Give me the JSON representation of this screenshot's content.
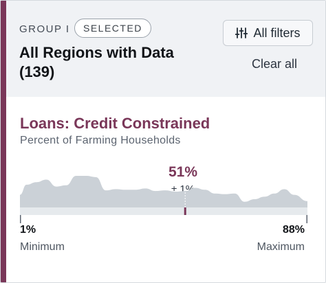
{
  "header": {
    "group_label": "GROUP I",
    "selected_badge": "SELECTED",
    "title": "All Regions with Data (139)",
    "all_filters_label": "All filters",
    "clear_all_label": "Clear all",
    "filters_icon": "sliders-icon"
  },
  "metric": {
    "title": "Loans: Credit Constrained",
    "subtitle": "Percent of Farming Households",
    "value": "51%",
    "margin_of_error": "± 1%",
    "min_value": "1%",
    "min_label": "Minimum",
    "max_value": "88%",
    "max_label": "Maximum"
  },
  "colors": {
    "accent": "#7a3759",
    "header_bg": "#f0f2f5",
    "distribution_fill": "#cbd1d7",
    "track": "#e6eaed"
  },
  "chart_data": {
    "type": "area",
    "x_range": [
      1,
      88
    ],
    "marker_value": 51,
    "x": [
      1,
      3,
      6,
      9,
      12,
      15,
      18,
      21,
      24,
      27,
      30,
      33,
      36,
      39,
      42,
      45,
      48,
      51,
      54,
      57,
      60,
      63,
      66,
      69,
      72,
      75,
      78,
      81,
      84,
      88
    ],
    "density": [
      0.4,
      0.72,
      0.8,
      0.88,
      0.66,
      0.7,
      1.0,
      1.0,
      0.96,
      0.54,
      0.58,
      0.56,
      0.56,
      0.6,
      0.52,
      0.54,
      0.5,
      0.52,
      0.62,
      0.56,
      0.44,
      0.42,
      0.44,
      0.18,
      0.26,
      0.34,
      0.44,
      0.58,
      0.4,
      0.2
    ]
  }
}
